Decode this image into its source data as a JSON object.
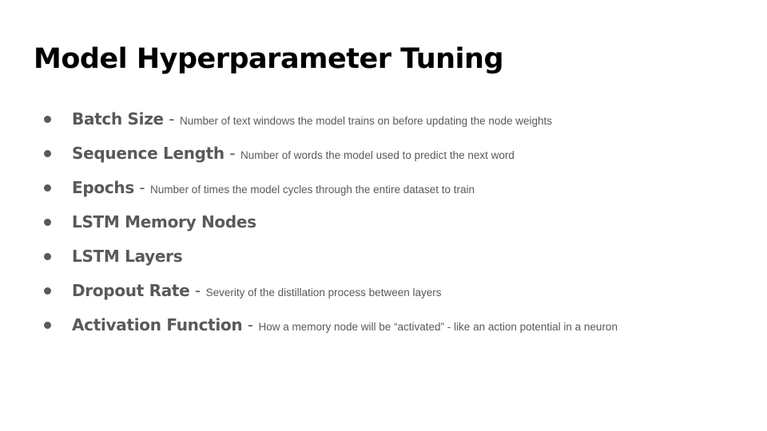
{
  "slide": {
    "title": "Model Hyperparameter Tuning",
    "bullets": [
      {
        "term": "Batch Size",
        "separator": "-",
        "description": "Number of text windows the model trains on before updating the node weights"
      },
      {
        "term": "Sequence Length",
        "separator": "-",
        "description": "Number of words the model used to predict the next word"
      },
      {
        "term": "Epochs",
        "separator": "-",
        "description": "Number of times the model cycles through the entire dataset to train"
      },
      {
        "term": "LSTM Memory Nodes"
      },
      {
        "term": "LSTM Layers"
      },
      {
        "term": "Dropout Rate",
        "separator": "-",
        "description": "Severity of the distillation process between layers"
      },
      {
        "term": "Activation Function",
        "separator": "-",
        "description": "How a memory node will be “activated” - like an action potential in a neuron"
      }
    ]
  },
  "colors": {
    "title": "#000000",
    "body_text": "#595959",
    "background": "#ffffff"
  }
}
